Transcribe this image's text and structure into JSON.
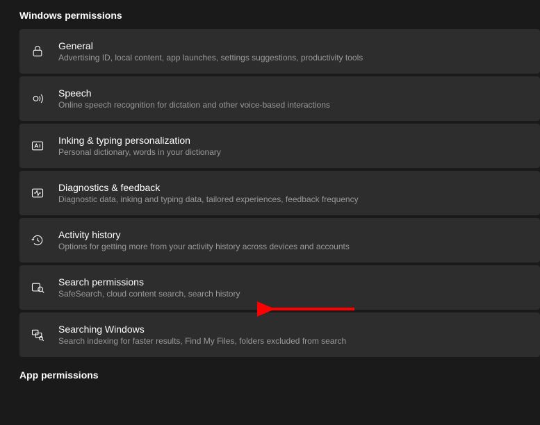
{
  "sections": {
    "windows_permissions": {
      "header": "Windows permissions",
      "items": [
        {
          "title": "General",
          "description": "Advertising ID, local content, app launches, settings suggestions, productivity tools"
        },
        {
          "title": "Speech",
          "description": "Online speech recognition for dictation and other voice-based interactions"
        },
        {
          "title": "Inking & typing personalization",
          "description": "Personal dictionary, words in your dictionary"
        },
        {
          "title": "Diagnostics & feedback",
          "description": "Diagnostic data, inking and typing data, tailored experiences, feedback frequency"
        },
        {
          "title": "Activity history",
          "description": "Options for getting more from your activity history across devices and accounts"
        },
        {
          "title": "Search permissions",
          "description": "SafeSearch, cloud content search, search history"
        },
        {
          "title": "Searching Windows",
          "description": "Search indexing for faster results, Find My Files, folders excluded from search"
        }
      ]
    },
    "app_permissions": {
      "header": "App permissions"
    }
  },
  "annotation": {
    "color": "#ff0000"
  }
}
